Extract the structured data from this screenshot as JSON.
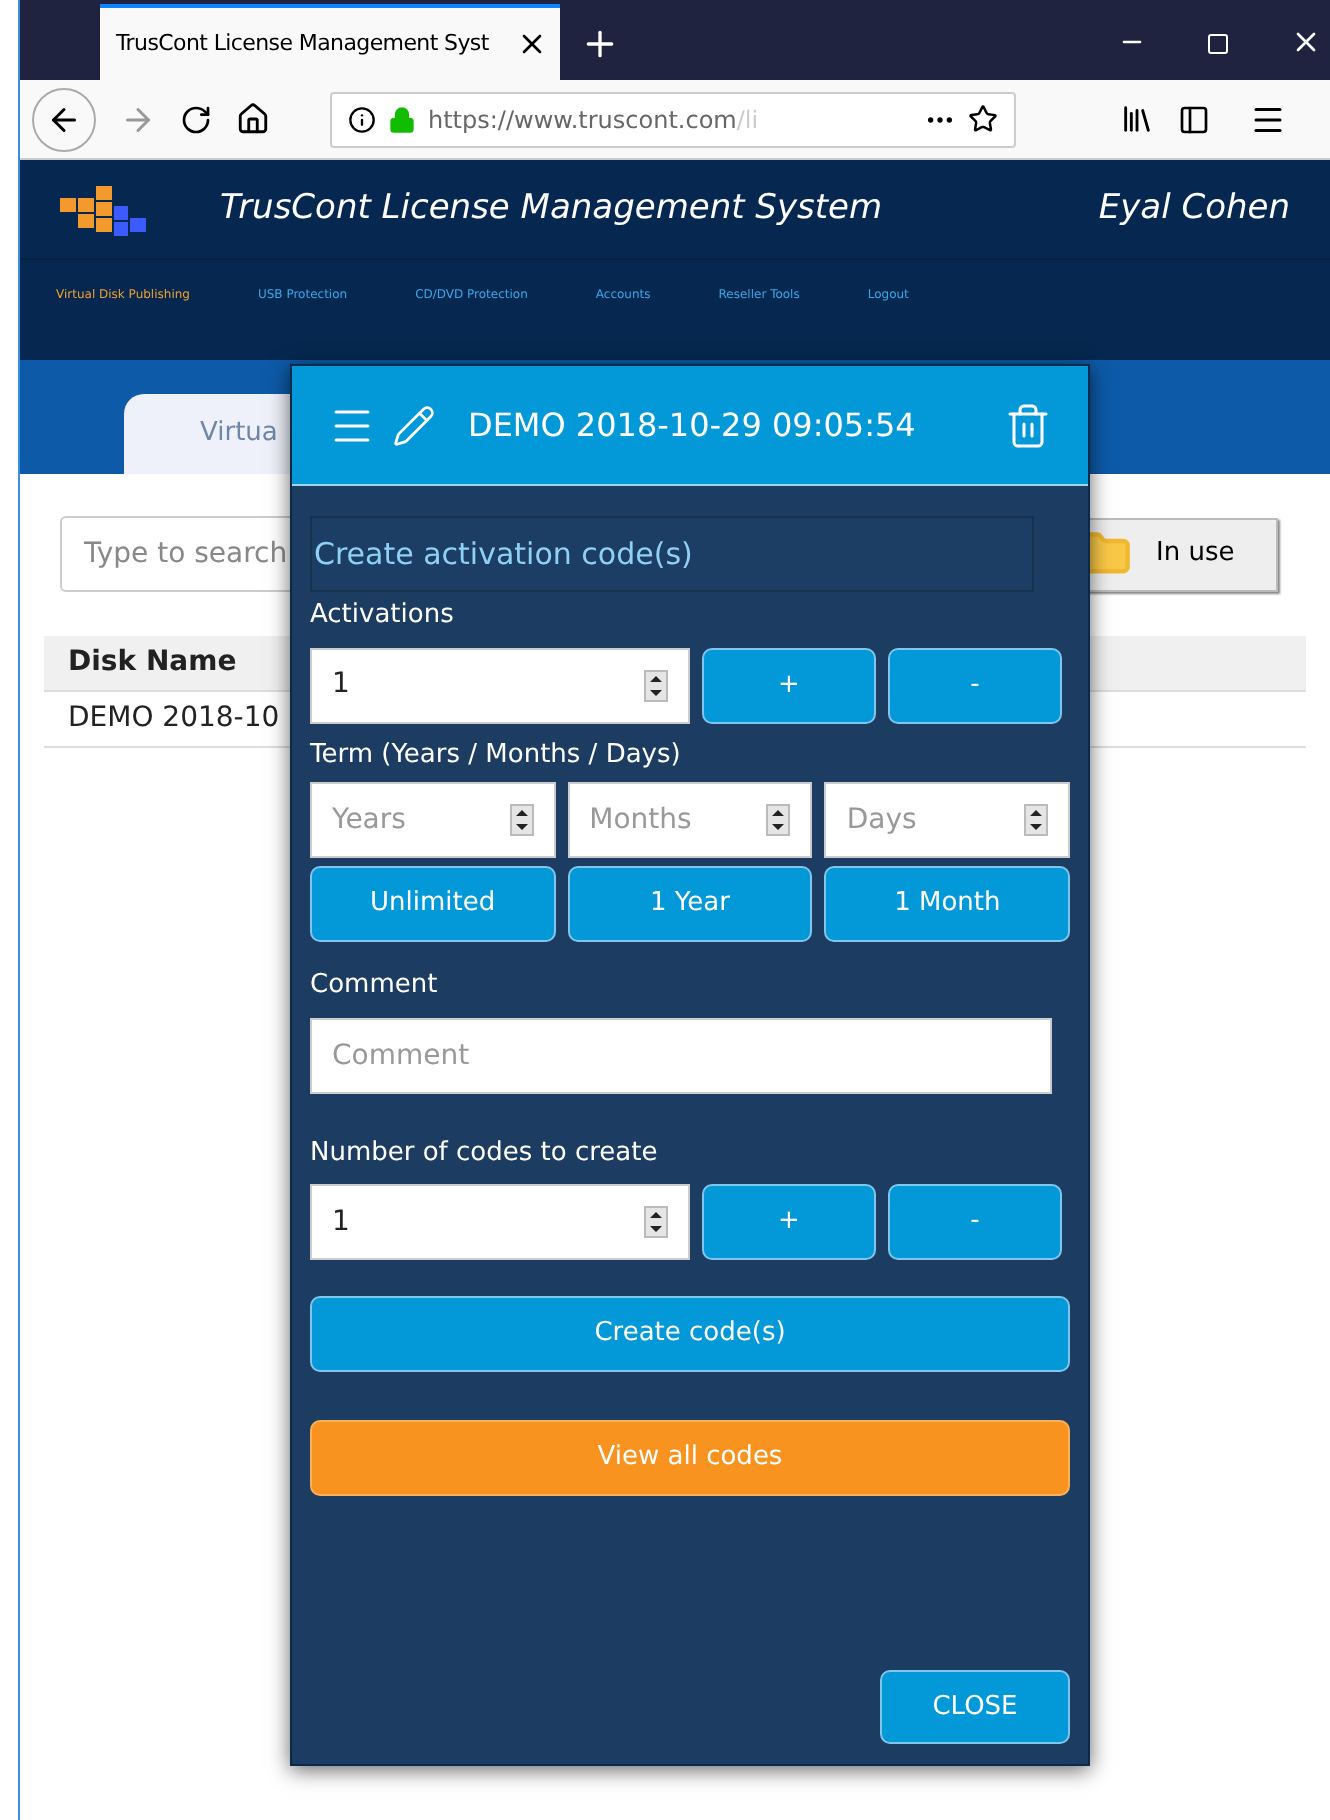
{
  "browser": {
    "tab_title": "TrusCont License Management Syst",
    "url_host": "https://www.truscont.com",
    "url_rest": "/li"
  },
  "header": {
    "title": "TrusCont License Management System",
    "user": "Eyal Cohen"
  },
  "nav": [
    {
      "label": "Virtual Disk Publishing",
      "selected": true
    },
    {
      "label": "USB Protection",
      "selected": false
    },
    {
      "label": "CD/DVD Protection",
      "selected": false
    },
    {
      "label": "Accounts",
      "selected": false
    },
    {
      "label": "Reseller Tools",
      "selected": false
    },
    {
      "label": "Logout",
      "selected": false
    }
  ],
  "page": {
    "tab": "Virtua",
    "search": {
      "placeholder": "Type to search"
    },
    "in_use_button": "In use",
    "table": {
      "columns": [
        "Disk Name"
      ],
      "rows": [
        [
          "DEMO 2018-10"
        ]
      ]
    }
  },
  "dialog": {
    "title": "DEMO 2018-10-29 09:05:54",
    "section": "Create activation code(s)",
    "activations": {
      "label": "Activations",
      "value": "1",
      "buttons": [
        "+",
        "-"
      ]
    },
    "term": {
      "label": "Term (Years / Months / Days)",
      "fields": [
        {
          "placeholder": "Years"
        },
        {
          "placeholder": "Months"
        },
        {
          "placeholder": "Days"
        }
      ],
      "presets": [
        "Unlimited",
        "1 Year",
        "1 Month"
      ]
    },
    "comment": {
      "label": "Comment",
      "placeholder": "Comment"
    },
    "codes": {
      "label": "Number of codes to create",
      "value": "1",
      "buttons": [
        "+",
        "-"
      ]
    },
    "create_button": "Create code(s)",
    "view_button": "View all codes",
    "close_button": "CLOSE"
  }
}
